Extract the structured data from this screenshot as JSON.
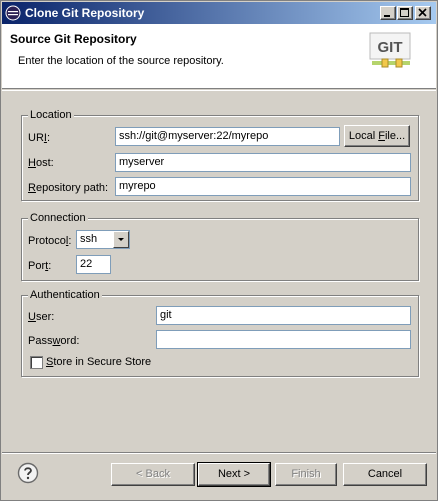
{
  "window": {
    "title": "Clone Git Repository"
  },
  "header": {
    "title": "Source Git Repository",
    "description": "Enter the location of the source repository.",
    "logo_text": "GIT"
  },
  "location": {
    "legend": "Location",
    "uri_label_pre": "UR",
    "uri_label_mnemonic": "I",
    "uri_label_post": ":",
    "uri_value": "ssh://git@myserver:22/myrepo",
    "local_file_pre": "Local ",
    "local_file_mnemonic": "F",
    "local_file_post": "ile...",
    "host_label_mnemonic": "H",
    "host_label_rest": "ost:",
    "host_value": "myserver",
    "repo_path_label_mnemonic": "R",
    "repo_path_label_rest": "epository path:",
    "repo_path_value": "myrepo"
  },
  "connection": {
    "legend": "Connection",
    "protocol_label_pre": "Protoco",
    "protocol_label_mnemonic": "l",
    "protocol_label_post": ":",
    "protocol_value": "ssh",
    "port_label_pre": "Por",
    "port_label_mnemonic": "t",
    "port_label_post": ":",
    "port_value": "22"
  },
  "authentication": {
    "legend": "Authentication",
    "user_label_mnemonic": "U",
    "user_label_rest": "ser:",
    "user_value": "git",
    "password_label_pre": "Pass",
    "password_label_mnemonic": "w",
    "password_label_post": "ord:",
    "password_value": "",
    "secure_store_mnemonic": "S",
    "secure_store_rest": "tore in Secure Store",
    "secure_store_checked": false
  },
  "footer": {
    "back_label": "< Back",
    "next_label": "Next >",
    "finish_label": "Finish",
    "cancel_label": "Cancel"
  },
  "icons": {
    "app": "eclipse-icon",
    "help": "help-icon",
    "logo": "git-logo"
  },
  "colors": {
    "title_bar_start": "#0a246a",
    "title_bar_end": "#a6caf0",
    "dialog_bg": "#d4d0c8",
    "help_blue": "#3a6ea5"
  }
}
